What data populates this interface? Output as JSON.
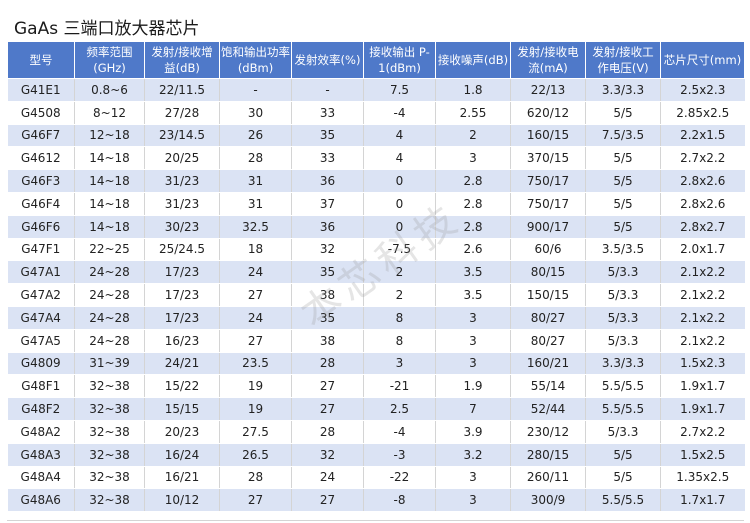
{
  "title": "GaAs 三端口放大器芯片",
  "watermark": "本芯科技",
  "headers": [
    "型号",
    "频率范围(GHz)",
    "发射/接收增益(dB)",
    "饱和输出功率(dBm)",
    "发射效率(%)",
    "接收输出 P-1(dBm)",
    "接收噪声(dB)",
    "发射/接收电流(mA)",
    "发射/接收工作电压(V)",
    "芯片尺寸(mm)"
  ],
  "rows": [
    [
      "G41E1",
      "0.8~6",
      "22/11.5",
      "-",
      "-",
      "7.5",
      "1.8",
      "22/13",
      "3.3/3.3",
      "2.5x2.3"
    ],
    [
      "G4508",
      "8~12",
      "27/28",
      "30",
      "33",
      "-4",
      "2.55",
      "620/12",
      "5/5",
      "2.85x2.5"
    ],
    [
      "G46F7",
      "12~18",
      "23/14.5",
      "26",
      "35",
      "4",
      "2",
      "160/15",
      "7.5/3.5",
      "2.2x1.5"
    ],
    [
      "G4612",
      "14~18",
      "20/25",
      "28",
      "33",
      "4",
      "3",
      "370/15",
      "5/5",
      "2.7x2.2"
    ],
    [
      "G46F3",
      "14~18",
      "31/23",
      "31",
      "36",
      "0",
      "2.8",
      "750/17",
      "5/5",
      "2.8x2.6"
    ],
    [
      "G46F4",
      "14~18",
      "31/23",
      "31",
      "37",
      "0",
      "2.8",
      "750/17",
      "5/5",
      "2.8x2.6"
    ],
    [
      "G46F6",
      "14~18",
      "30/23",
      "32.5",
      "36",
      "0",
      "2.8",
      "900/17",
      "5/5",
      "2.8x2.7"
    ],
    [
      "G47F1",
      "22~25",
      "25/24.5",
      "18",
      "32",
      "-7.5",
      "2.6",
      "60/6",
      "3.5/3.5",
      "2.0x1.7"
    ],
    [
      "G47A1",
      "24~28",
      "17/23",
      "24",
      "35",
      "2",
      "3.5",
      "80/15",
      "5/3.3",
      "2.1x2.2"
    ],
    [
      "G47A2",
      "24~28",
      "17/23",
      "27",
      "38",
      "2",
      "3.5",
      "150/15",
      "5/3.3",
      "2.1x2.2"
    ],
    [
      "G47A4",
      "24~28",
      "17/23",
      "24",
      "35",
      "8",
      "3",
      "80/27",
      "5/3.3",
      "2.1x2.2"
    ],
    [
      "G47A5",
      "24~28",
      "16/23",
      "27",
      "38",
      "8",
      "3",
      "80/27",
      "5/3.3",
      "2.1x2.2"
    ],
    [
      "G4809",
      "31~39",
      "24/21",
      "23.5",
      "28",
      "3",
      "3",
      "160/21",
      "3.3/3.3",
      "1.5x2.3"
    ],
    [
      "G48F1",
      "32~38",
      "15/22",
      "19",
      "27",
      "-21",
      "1.9",
      "55/14",
      "5.5/5.5",
      "1.9x1.7"
    ],
    [
      "G48F2",
      "32~38",
      "15/15",
      "19",
      "27",
      "2.5",
      "7",
      "52/44",
      "5.5/5.5",
      "1.9x1.7"
    ],
    [
      "G48A2",
      "32~38",
      "20/23",
      "27.5",
      "28",
      "-4",
      "3.9",
      "230/12",
      "5/3.3",
      "2.7x2.2"
    ],
    [
      "G48A3",
      "32~38",
      "16/24",
      "26.5",
      "32",
      "-3",
      "3.2",
      "280/15",
      "5/5",
      "1.5x2.5"
    ],
    [
      "G48A4",
      "32~38",
      "16/21",
      "28",
      "24",
      "-22",
      "3",
      "260/11",
      "5/5",
      "1.35x2.5"
    ],
    [
      "G48A6",
      "32~38",
      "10/12",
      "27",
      "27",
      "-8",
      "3",
      "300/9",
      "5.5/5.5",
      "1.7x1.7"
    ]
  ]
}
